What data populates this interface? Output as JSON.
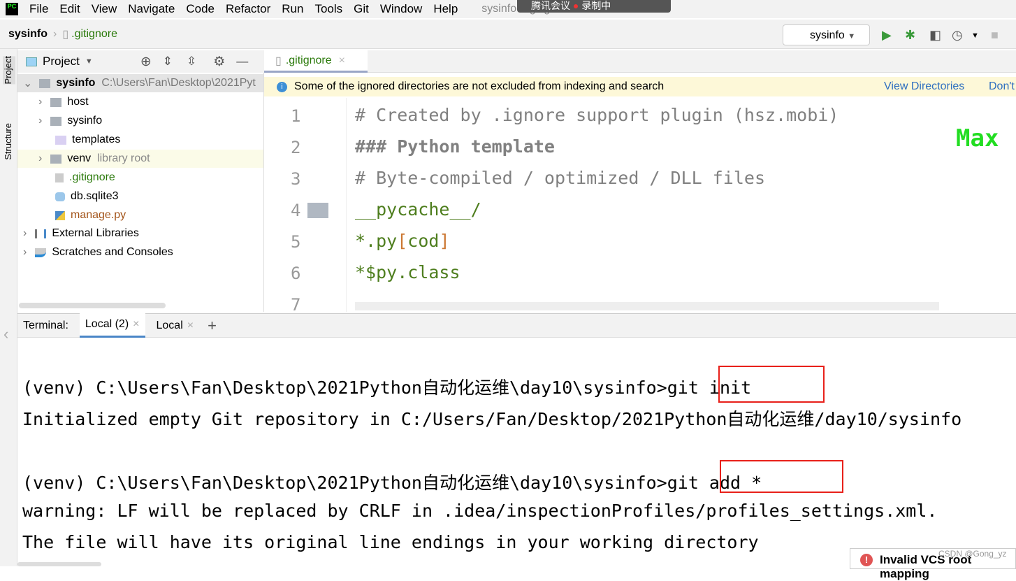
{
  "menu": [
    "File",
    "Edit",
    "View",
    "Navigate",
    "Code",
    "Refactor",
    "Run",
    "Tools",
    "Git",
    "Window",
    "Help"
  ],
  "window_title": "sysinfo - .gitignore",
  "overlay": {
    "meeting": "腾讯会议",
    "recording": "录制中"
  },
  "nav": {
    "project": "sysinfo",
    "file": ".gitignore",
    "run_config": "sysinfo"
  },
  "side_tabs": {
    "project": "Project",
    "structure": "Structure"
  },
  "project_panel": {
    "title": "Project",
    "tree": [
      {
        "name": "sysinfo",
        "extra": "C:\\Users\\Fan\\Desktop\\2021Pyt"
      },
      {
        "name": "host"
      },
      {
        "name": "sysinfo"
      },
      {
        "name": "templates"
      },
      {
        "name": "venv",
        "extra": "library root"
      },
      {
        "name": ".gitignore"
      },
      {
        "name": "db.sqlite3"
      },
      {
        "name": "manage.py"
      },
      {
        "name": "External Libraries"
      },
      {
        "name": "Scratches and Consoles"
      }
    ]
  },
  "editor": {
    "tab": ".gitignore",
    "banner": {
      "text": "Some of the ignored directories are not excluded from indexing and search",
      "view": "View Directories",
      "dont": "Don't"
    },
    "lines": [
      "# Created by .ignore support plugin (hsz.mobi)",
      "### Python template",
      "# Byte-compiled / optimized / DLL files",
      "__pycache__/",
      "*.py[cod]",
      "*$py.class",
      ""
    ],
    "line_numbers": [
      "1",
      "2",
      "3",
      "4",
      "5",
      "6",
      "7"
    ],
    "corner": "Max"
  },
  "terminal": {
    "label": "Terminal:",
    "tabs": [
      "Local (2)",
      "Local"
    ],
    "add": "+",
    "lines": [
      "",
      "(venv) C:\\Users\\Fan\\Desktop\\2021Python自动化运维\\day10\\sysinfo>git init",
      "Initialized empty Git repository in C:/Users/Fan/Desktop/2021Python自动化运维/day10/sysinfo",
      "",
      "(venv) C:\\Users\\Fan\\Desktop\\2021Python自动化运维\\day10\\sysinfo>git add *",
      "warning: LF will be replaced by CRLF in .idea/inspectionProfiles/profiles_settings.xml.",
      "The file will have its original line endings in your working directory"
    ]
  },
  "notification": "Invalid VCS root mapping",
  "watermark": "CSDN @Gong_yz"
}
